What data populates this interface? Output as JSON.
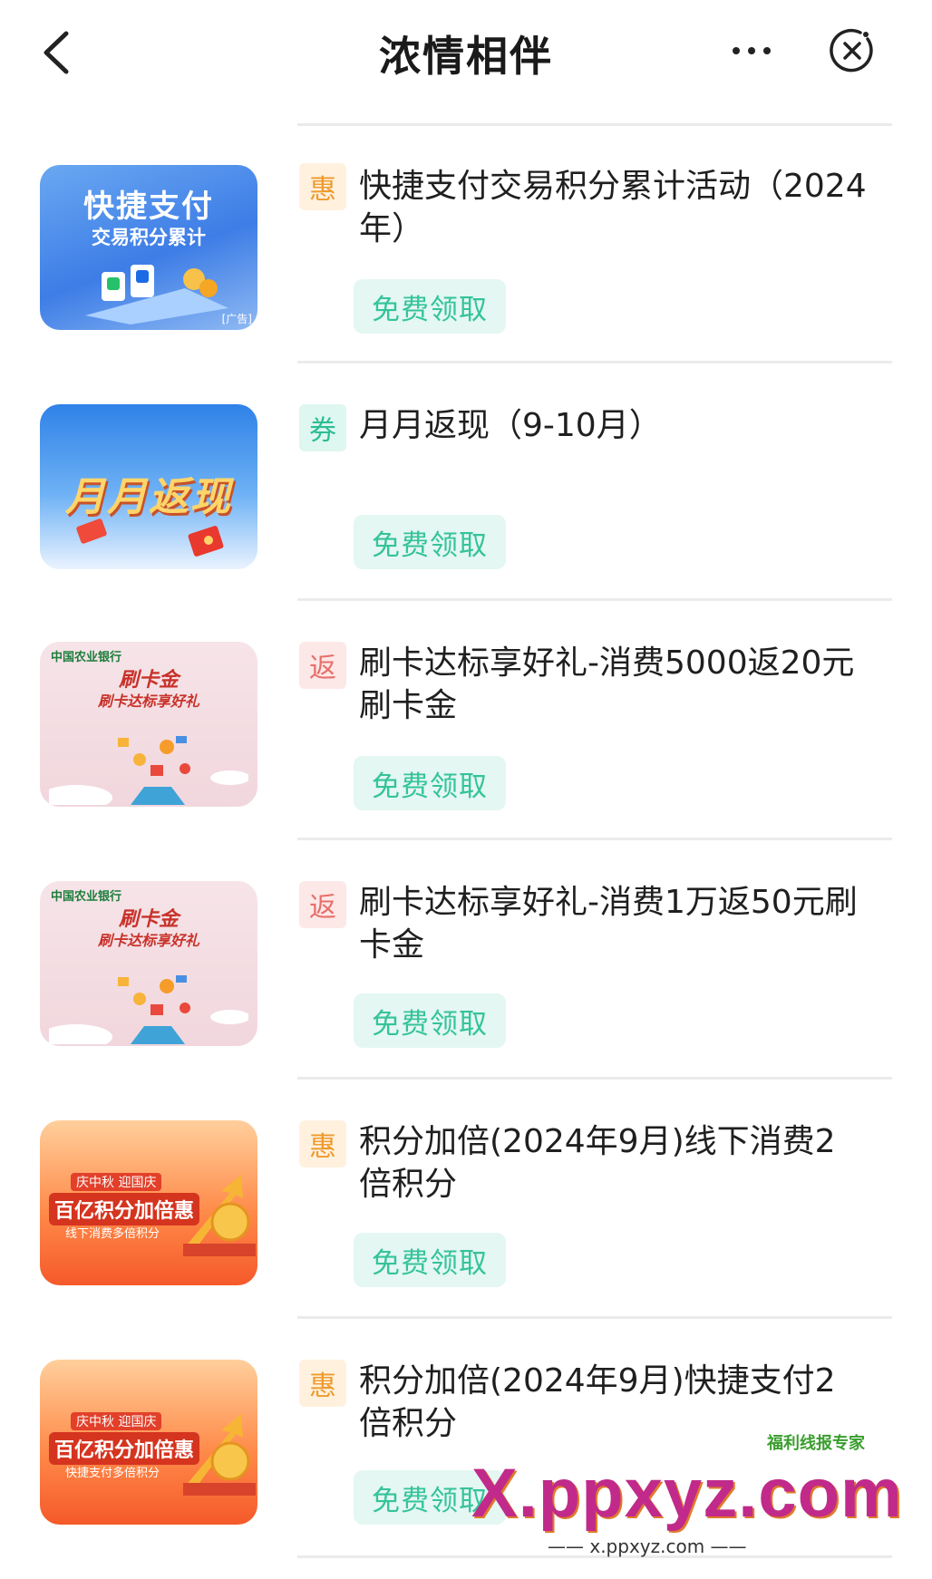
{
  "header": {
    "title": "浓情相伴",
    "back_icon": "chevron-left-icon",
    "more_icon": "more-dots-icon",
    "close_icon": "close-circle-icon"
  },
  "items": [
    {
      "tag": "惠",
      "tag_color": "orange",
      "title": "快捷支付交易积分累计活动（2024年）",
      "button": "免费领取",
      "thumb": {
        "line1": "快捷支付",
        "line2": "交易积分累计",
        "badge": "[广告]"
      }
    },
    {
      "tag": "券",
      "tag_color": "green",
      "title": "月月返现（9-10月）",
      "button": "免费领取",
      "thumb": {
        "line1": "月月返现"
      }
    },
    {
      "tag": "返",
      "tag_color": "red",
      "title": "刷卡达标享好礼-消费5000返20元刷卡金",
      "button": "免费领取",
      "thumb": {
        "bank": "中国农业银行",
        "line1": "刷卡金",
        "line2": "刷卡达标享好礼"
      }
    },
    {
      "tag": "返",
      "tag_color": "red",
      "title": "刷卡达标享好礼-消费1万返50元刷卡金",
      "button": "免费领取",
      "thumb": {
        "bank": "中国农业银行",
        "line1": "刷卡金",
        "line2": "刷卡达标享好礼"
      }
    },
    {
      "tag": "惠",
      "tag_color": "orange",
      "title": "积分加倍(2024年9月)线下消费2倍积分",
      "button": "免费领取",
      "thumb": {
        "small": "庆中秋 迎国庆",
        "line1": "百亿积分加倍惠",
        "line2": "线下消费多倍积分"
      }
    },
    {
      "tag": "惠",
      "tag_color": "orange",
      "title": "积分加倍(2024年9月)快捷支付2倍积分",
      "button": "免费领取",
      "thumb": {
        "small": "庆中秋 迎国庆",
        "line1": "百亿积分加倍惠",
        "line2": "快捷支付多倍积分"
      }
    }
  ],
  "watermark": {
    "label": "福利线报专家",
    "big": "X.ppxyz.com",
    "small": "—— x.ppxyz.com ——"
  },
  "colors": {
    "tag_orange": "#ef9a2c",
    "tag_green": "#2dbd93",
    "tag_red": "#e7706a",
    "button_text": "#35c39a",
    "button_bg": "#e4f7f2"
  }
}
